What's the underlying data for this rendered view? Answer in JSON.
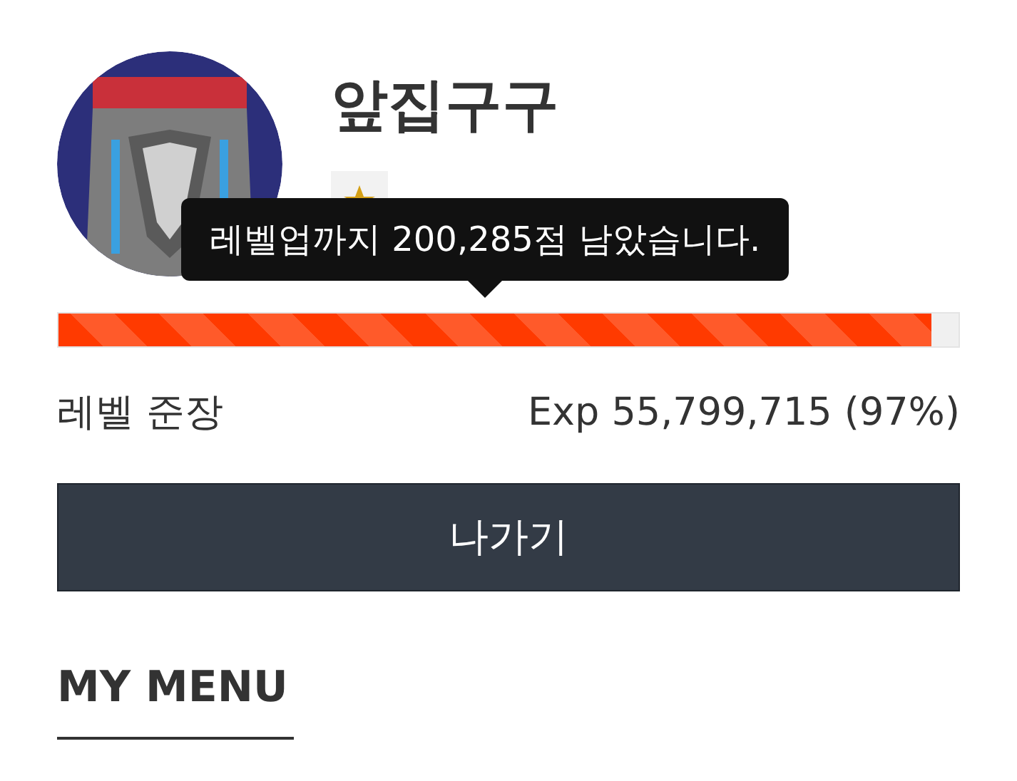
{
  "profile": {
    "nickname": "앞집구구"
  },
  "tooltip": "레벨업까지 200,285점 남았습니다.",
  "progress": {
    "level": 0.97
  },
  "level_label": "레벨 준장",
  "exp_reading": "Exp 55,799,715 (97%)",
  "exit_button": "나가기",
  "section_title": "MY MENU"
}
